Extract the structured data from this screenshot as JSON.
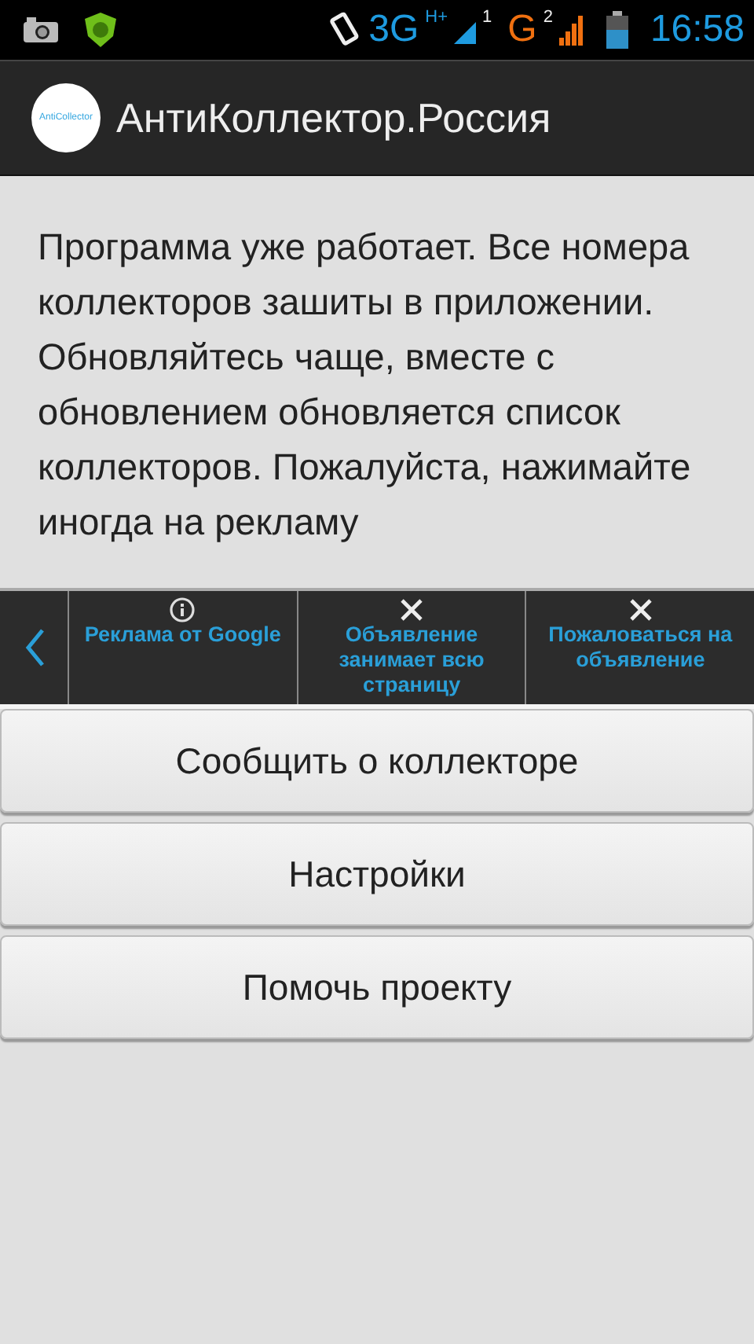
{
  "status_bar": {
    "network_3g": "3G",
    "network_hplus": "H+",
    "sim_1": "1",
    "network_g": "G",
    "sim_2": "2",
    "time": "16:58"
  },
  "action_bar": {
    "logo_text": "AntiCollector",
    "title": "АнтиКоллектор.Россия"
  },
  "message": "Программа уже работает. Все номера коллекторов зашиты в приложении. Обновляйтесь чаще, вместе с обновлением обновляется список коллекторов. Пожалуйста, нажимайте иногда на рекламу",
  "ad_bar": {
    "items": [
      {
        "kind": "info",
        "label": "Реклама от Google"
      },
      {
        "kind": "close",
        "label": "Объявление занимает всю страницу"
      },
      {
        "kind": "close",
        "label": "Пожаловаться на объявление"
      }
    ]
  },
  "buttons": [
    "Сообщить о коллекторе",
    "Настройки",
    "Помочь проекту"
  ]
}
